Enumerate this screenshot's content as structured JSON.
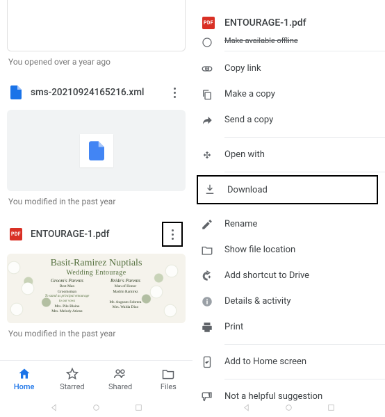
{
  "left": {
    "card_partial_meta": "You opened over a year ago",
    "file1": {
      "name": "sms-20210924165216.xml",
      "meta": "You modified in the past year"
    },
    "file2": {
      "name": "ENTOURAGE-1.pdf",
      "meta": "You modified in the past year",
      "preview": {
        "title": "Basit-Ramirez Nuptials",
        "subtitle": "Wedding Entourage",
        "left_heading": "Groom's Parents",
        "right_heading": "Bride's Parents",
        "note": "To stand as principal entourage to our vows",
        "left_lines": [
          "Best Man",
          "Groomsman",
          "Mrs. Pile Blaine",
          "Mrs. Melody Atienz"
        ],
        "right_lines": [
          "Man of Honor",
          "Madrin Ramirez",
          "Mr. Augusto Sobrera",
          "Mrs. Walda Dizo"
        ]
      }
    },
    "nav": {
      "home": "Home",
      "starred": "Starred",
      "shared": "Shared",
      "files": "Files"
    }
  },
  "right": {
    "header_file": "ENTOURAGE-1.pdf",
    "clipped": "Make available offline",
    "groups": [
      [
        {
          "icon": "link",
          "label": "Copy link"
        },
        {
          "icon": "copy",
          "label": "Make a copy"
        },
        {
          "icon": "send",
          "label": "Send a copy"
        }
      ],
      [
        {
          "icon": "openwith",
          "label": "Open with"
        }
      ],
      [
        {
          "icon": "download",
          "label": "Download",
          "highlight": true
        }
      ],
      [
        {
          "icon": "rename",
          "label": "Rename"
        },
        {
          "icon": "folder",
          "label": "Show file location"
        },
        {
          "icon": "shortcut",
          "label": "Add shortcut to Drive"
        },
        {
          "icon": "info",
          "label": "Details & activity"
        },
        {
          "icon": "print",
          "label": "Print"
        }
      ],
      [
        {
          "icon": "addhome",
          "label": "Add to Home screen"
        }
      ],
      [
        {
          "icon": "thumbdown",
          "label": "Not a helpful suggestion"
        }
      ]
    ]
  }
}
